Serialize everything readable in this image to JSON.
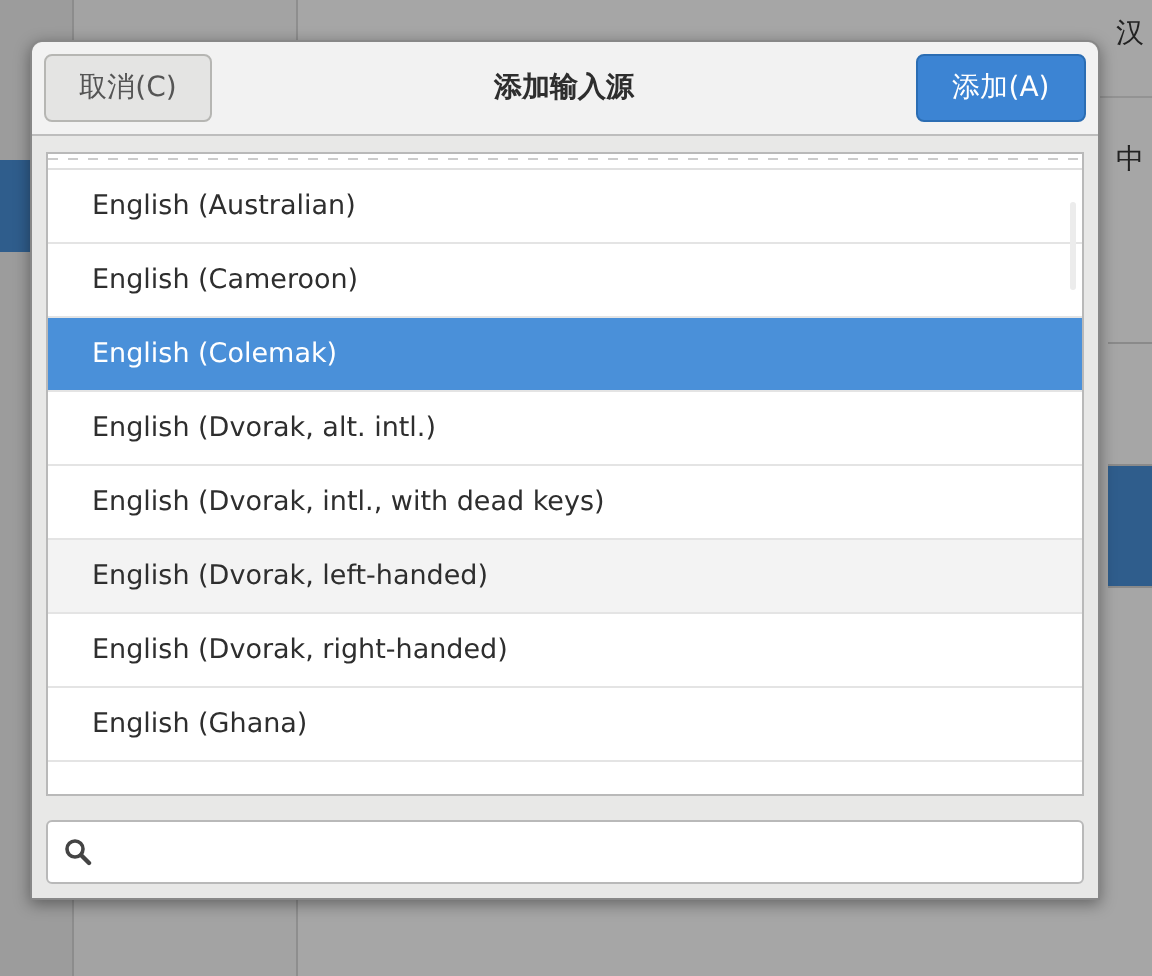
{
  "background": {
    "language_value": "汉",
    "format_value": "中"
  },
  "dialog": {
    "title": "添加输入源",
    "cancel_button": "取消(C)",
    "add_button": "添加(A)",
    "items": [
      {
        "label": "English (Australian)",
        "selected": false,
        "hovered": false
      },
      {
        "label": "English (Cameroon)",
        "selected": false,
        "hovered": false
      },
      {
        "label": "English (Colemak)",
        "selected": true,
        "hovered": false
      },
      {
        "label": "English (Dvorak, alt. intl.)",
        "selected": false,
        "hovered": false
      },
      {
        "label": "English (Dvorak, intl., with dead keys)",
        "selected": false,
        "hovered": false
      },
      {
        "label": "English (Dvorak, left-handed)",
        "selected": false,
        "hovered": true
      },
      {
        "label": "English (Dvorak, right-handed)",
        "selected": false,
        "hovered": false
      },
      {
        "label": "English (Ghana)",
        "selected": false,
        "hovered": false
      }
    ]
  }
}
